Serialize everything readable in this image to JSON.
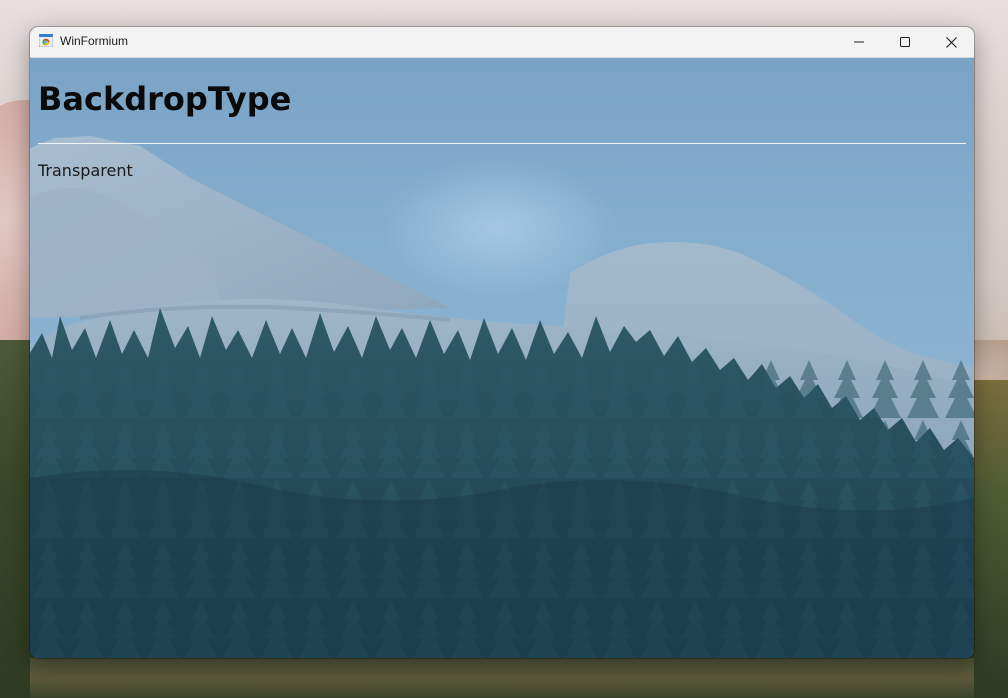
{
  "window": {
    "title": "WinFormium",
    "icon": "chromium-app-icon",
    "controls": {
      "minimize": "minimize-icon",
      "maximize": "maximize-icon",
      "close": "close-icon"
    }
  },
  "page": {
    "heading": "BackdropType",
    "value": "Transparent"
  },
  "colors": {
    "titlebar": "#f3f3f3",
    "heading_text": "#0a0a0a",
    "body_text": "#1a1a1a",
    "backdrop_tint": "#6d9fc4"
  }
}
